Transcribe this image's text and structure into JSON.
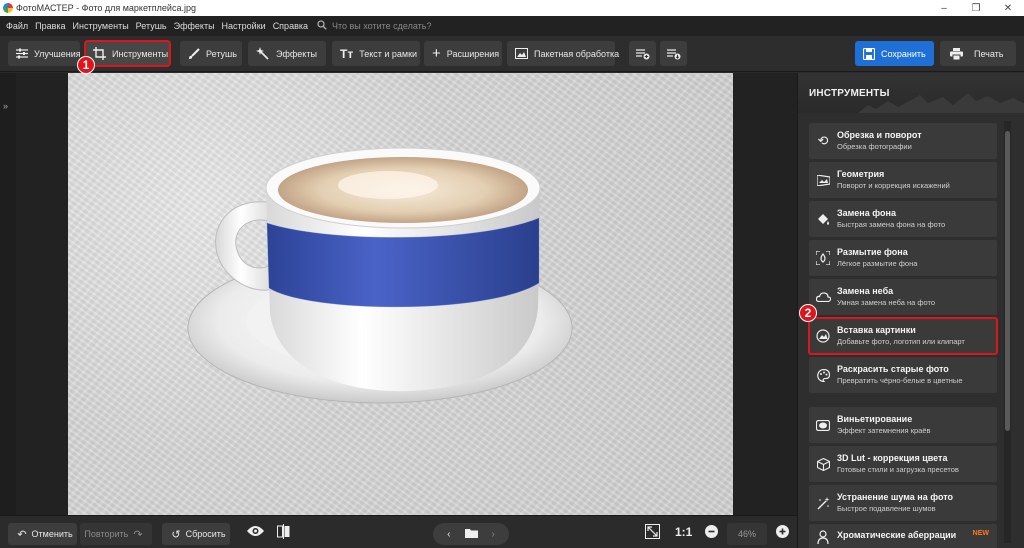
{
  "window": {
    "title": "ФотоМАСТЕР - Фото для маркетплейса.jpg",
    "controls": [
      "–",
      "❐",
      "✕"
    ]
  },
  "menu": {
    "items": [
      "Файл",
      "Правка",
      "Инструменты",
      "Ретушь",
      "Эффекты",
      "Настройки",
      "Справка"
    ],
    "search_placeholder": "Что вы хотите сделать?"
  },
  "toolbar": {
    "tabs": [
      {
        "label": "Улучшения",
        "icon": "sliders-icon"
      },
      {
        "label": "Инструменты",
        "icon": "crop-icon",
        "active": true
      },
      {
        "label": "Ретушь",
        "icon": "brush-icon"
      },
      {
        "label": "Эффекты",
        "icon": "magic-wand-icon"
      },
      {
        "label": "Текст и рамки",
        "icon": "text-icon"
      },
      {
        "label": "Расширения",
        "icon": "plus-icon"
      }
    ],
    "batch_label": "Пакетная обработка",
    "save_label": "Сохранить",
    "print_label": "Печать"
  },
  "annotations": {
    "badge1": "1",
    "badge2": "2",
    "color": "#e0151b"
  },
  "panel": {
    "title": "ИНСТРУМЕНТЫ",
    "tools": [
      {
        "title": "Обрезка и поворот",
        "desc": "Обрезка фотографии",
        "icon": "crop-rotate-icon"
      },
      {
        "title": "Геометрия",
        "desc": "Поворот и коррекция искажений",
        "icon": "geometry-icon"
      },
      {
        "title": "Замена фона",
        "desc": "Быстрая замена фона на фото",
        "icon": "fill-bucket-icon"
      },
      {
        "title": "Размытие фона",
        "desc": "Лёгкое размытие фона",
        "icon": "blur-icon"
      },
      {
        "title": "Замена неба",
        "desc": "Умная замена неба на фото",
        "icon": "cloud-icon"
      },
      {
        "title": "Вставка картинки",
        "desc": "Добавьте фото, логотип или клипарт",
        "icon": "insert-image-icon",
        "highlighted": true
      },
      {
        "title": "Раскрасить старые фото",
        "desc": "Превратить чёрно-белые в цветные",
        "icon": "palette-icon"
      },
      {
        "title": "Виньетирование",
        "desc": "Эффект затемнения краёв",
        "icon": "vignette-icon"
      },
      {
        "title": "3D Lut - коррекция цвета",
        "desc": "Готовые стили и загрузка пресетов",
        "icon": "cube-icon"
      },
      {
        "title": "Устранение шума на фото",
        "desc": "Быстрое подавление шумов",
        "icon": "noise-icon"
      },
      {
        "title": "Хроматические аберрации",
        "desc": "",
        "icon": "aberration-icon",
        "badge": "NEW"
      }
    ]
  },
  "bottom": {
    "undo_label": "Отменить",
    "redo_label": "Повторить",
    "reset_label": "Сбросить",
    "ratio_label": "1:1",
    "zoom_value": "46%"
  },
  "colors": {
    "accent": "#1e70d6",
    "highlight": "#e0151b",
    "new_badge": "#ff7a1a",
    "cup_stripe": "#3b55b8"
  }
}
